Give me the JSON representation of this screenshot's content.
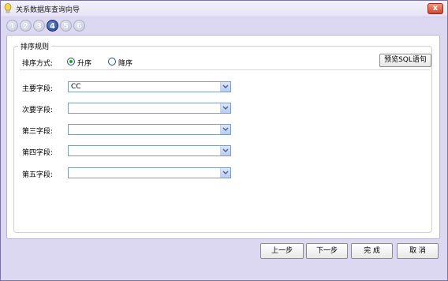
{
  "window": {
    "title": "关系数据库查询向导",
    "close_glyph": "x"
  },
  "steps": [
    {
      "label": "1",
      "active": false
    },
    {
      "label": "2",
      "active": false
    },
    {
      "label": "3",
      "active": false
    },
    {
      "label": "4",
      "active": true
    },
    {
      "label": "5",
      "active": false
    },
    {
      "label": "6",
      "active": false
    }
  ],
  "sort_rules": {
    "group_title": "排序规则",
    "mode_label": "排序方式:",
    "ascending_label": "升序",
    "descending_label": "降序",
    "selected": "ascending",
    "preview_sql_label": "预览SQL语句"
  },
  "fields": [
    {
      "label": "主要字段:",
      "value": "CC"
    },
    {
      "label": "次要字段:",
      "value": ""
    },
    {
      "label": "第三字段:",
      "value": ""
    },
    {
      "label": "第四字段:",
      "value": ""
    },
    {
      "label": "第五字段:",
      "value": ""
    }
  ],
  "buttons": {
    "prev": "上一步",
    "next": "下一步",
    "finish": "完  成",
    "cancel": "取  消"
  },
  "colors": {
    "window_bg": "#ddd8f1",
    "active_step": "#1f3f8a",
    "radio_selected": "#21a121"
  }
}
